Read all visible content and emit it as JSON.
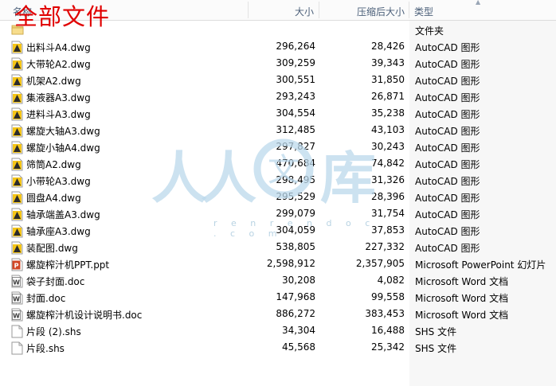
{
  "overlay": {
    "title": "全部文件"
  },
  "watermark": {
    "chars": [
      "人",
      "人",
      "文",
      "库"
    ],
    "url": "r e n r e n d o c . c o m"
  },
  "columns": {
    "name": "名称",
    "size": "大小",
    "compressed": "压缩后大小",
    "type": "类型"
  },
  "files": [
    {
      "name": "",
      "size": "",
      "compressed": "",
      "type": "文件夹",
      "icon": "folder-icon"
    },
    {
      "name": "出料斗A4.dwg",
      "size": "296,264",
      "compressed": "28,426",
      "type": "AutoCAD 图形",
      "icon": "autocad-file-icon"
    },
    {
      "name": "大带轮A2.dwg",
      "size": "309,259",
      "compressed": "39,343",
      "type": "AutoCAD 图形",
      "icon": "autocad-file-icon"
    },
    {
      "name": "机架A2.dwg",
      "size": "300,551",
      "compressed": "31,850",
      "type": "AutoCAD 图形",
      "icon": "autocad-file-icon"
    },
    {
      "name": "集液器A3.dwg",
      "size": "293,243",
      "compressed": "26,871",
      "type": "AutoCAD 图形",
      "icon": "autocad-file-icon"
    },
    {
      "name": "进料斗A3.dwg",
      "size": "304,554",
      "compressed": "35,238",
      "type": "AutoCAD 图形",
      "icon": "autocad-file-icon"
    },
    {
      "name": "螺旋大轴A3.dwg",
      "size": "312,485",
      "compressed": "43,103",
      "type": "AutoCAD 图形",
      "icon": "autocad-file-icon"
    },
    {
      "name": "螺旋小轴A4.dwg",
      "size": "297,827",
      "compressed": "30,243",
      "type": "AutoCAD 图形",
      "icon": "autocad-file-icon"
    },
    {
      "name": "筛筒A2.dwg",
      "size": "470,684",
      "compressed": "74,842",
      "type": "AutoCAD 图形",
      "icon": "autocad-file-icon"
    },
    {
      "name": "小带轮A3.dwg",
      "size": "298,495",
      "compressed": "31,326",
      "type": "AutoCAD 图形",
      "icon": "autocad-file-icon"
    },
    {
      "name": "圆盘A4.dwg",
      "size": "295,529",
      "compressed": "28,396",
      "type": "AutoCAD 图形",
      "icon": "autocad-file-icon"
    },
    {
      "name": "轴承端盖A3.dwg",
      "size": "299,079",
      "compressed": "31,754",
      "type": "AutoCAD 图形",
      "icon": "autocad-file-icon"
    },
    {
      "name": "轴承座A3.dwg",
      "size": "304,059",
      "compressed": "37,853",
      "type": "AutoCAD 图形",
      "icon": "autocad-file-icon"
    },
    {
      "name": "装配图.dwg",
      "size": "538,805",
      "compressed": "227,332",
      "type": "AutoCAD 图形",
      "icon": "autocad-file-icon"
    },
    {
      "name": "螺旋榨汁机PPT.ppt",
      "size": "2,598,912",
      "compressed": "2,357,905",
      "type": "Microsoft PowerPoint 幻灯片",
      "icon": "powerpoint-file-icon"
    },
    {
      "name": "袋子封面.doc",
      "size": "30,208",
      "compressed": "4,082",
      "type": "Microsoft Word 文档",
      "icon": "word-file-icon"
    },
    {
      "name": "封面.doc",
      "size": "147,968",
      "compressed": "99,558",
      "type": "Microsoft Word 文档",
      "icon": "word-file-icon"
    },
    {
      "name": "螺旋榨汁机设计说明书.doc",
      "size": "886,272",
      "compressed": "383,453",
      "type": "Microsoft Word 文档",
      "icon": "word-file-icon"
    },
    {
      "name": "片段 (2).shs",
      "size": "34,304",
      "compressed": "16,488",
      "type": "SHS 文件",
      "icon": "shs-file-icon"
    },
    {
      "name": "片段.shs",
      "size": "45,568",
      "compressed": "25,342",
      "type": "SHS 文件",
      "icon": "shs-file-icon"
    }
  ]
}
